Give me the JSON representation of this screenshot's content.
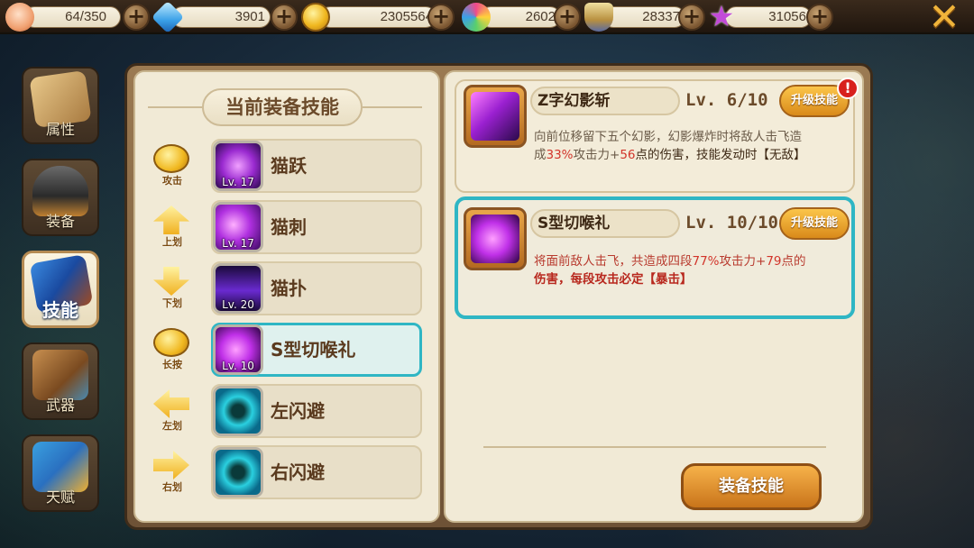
{
  "resources": [
    {
      "icon": "stamina-bun-icon",
      "value": "64/350"
    },
    {
      "icon": "blue-diamond-icon",
      "value": "3901"
    },
    {
      "icon": "gold-coin-icon",
      "value": "2305564"
    },
    {
      "icon": "candy-lollipop-icon",
      "value": "2602"
    },
    {
      "icon": "honor-badge-icon",
      "value": "28337"
    },
    {
      "icon": "purple-star-icon",
      "value": "31056"
    }
  ],
  "close_label": "✕",
  "tabs": [
    {
      "name": "tab-attributes",
      "label": "属性",
      "icon": "scroll-icon",
      "active": false
    },
    {
      "name": "tab-equipment",
      "label": "装备",
      "icon": "helmet-icon",
      "active": false
    },
    {
      "name": "tab-skills",
      "label": "技能",
      "icon": "skill-book-icon",
      "active": true
    },
    {
      "name": "tab-weapons",
      "label": "武器",
      "icon": "bow-quiver-icon",
      "active": false
    },
    {
      "name": "tab-talent",
      "label": "天赋",
      "icon": "rising-arrow-icon",
      "active": false
    }
  ],
  "left_panel": {
    "title": "当前装备技能",
    "slots": [
      {
        "gesture": "攻击",
        "gesture_icon": "tap-attack-icon",
        "skill": "猫跃",
        "level": "Lv. 17",
        "skill_icon": "cat-leap-skill-icon",
        "selected": false
      },
      {
        "gesture": "上划",
        "gesture_icon": "swipe-up-icon",
        "skill": "猫刺",
        "level": "Lv. 17",
        "skill_icon": "cat-thrust-skill-icon",
        "selected": false
      },
      {
        "gesture": "下划",
        "gesture_icon": "swipe-down-icon",
        "skill": "猫扑",
        "level": "Lv. 20",
        "skill_icon": "cat-pounce-skill-icon",
        "selected": false
      },
      {
        "gesture": "长按",
        "gesture_icon": "long-press-icon",
        "skill": "S型切喉礼",
        "level": "Lv. 10",
        "skill_icon": "s-slash-skill-icon",
        "selected": true
      },
      {
        "gesture": "左划",
        "gesture_icon": "swipe-left-icon",
        "skill": "左闪避",
        "level": "",
        "skill_icon": "dodge-left-skill-icon",
        "selected": false
      },
      {
        "gesture": "右划",
        "gesture_icon": "swipe-right-icon",
        "skill": "右闪避",
        "level": "",
        "skill_icon": "dodge-right-skill-icon",
        "selected": false
      }
    ]
  },
  "right_panel": {
    "cards": [
      {
        "name": "Z字幻影斩",
        "level": "Lv.  6/10",
        "upgrade_label": "升级技能",
        "badge": "!",
        "desc_line1": "向前位移留下五个幻影，幻影爆炸时将敌人击飞造",
        "desc_pre": "成",
        "desc_pct": "33%",
        "desc_mid": "攻击力+",
        "desc_flat": "56",
        "desc_post": "点的伤害，技能发动时【无敌】",
        "selected": false
      },
      {
        "name": "S型切喉礼",
        "level": "Lv. 10/10",
        "upgrade_label": "升级技能",
        "desc_line1_pre": "将面前敌人击飞，共造成四段",
        "desc_pct": "77%",
        "desc_mid": "攻击力+",
        "desc_flat": "79",
        "desc_post": "点的",
        "desc_line2": "伤害，每段攻击必定【暴击】",
        "selected": true
      }
    ],
    "equip_label": "装备技能"
  },
  "colors": {
    "accent_cyan": "#2fb6c4",
    "button_orange": "#e49a2a",
    "highlight_red": "#d2342a",
    "parchment": "#f1ead6"
  }
}
